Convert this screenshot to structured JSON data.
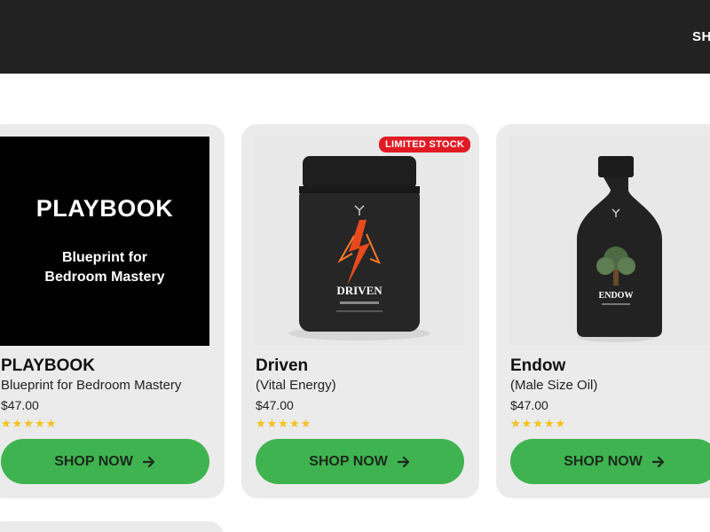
{
  "header": {
    "nav_shop": "SH"
  },
  "products": [
    {
      "name": "PLAYBOOK",
      "desc": "Blueprint for Bedroom Mastery",
      "price": "$47.00",
      "stars": "★★★★★",
      "cta": "SHOP NOW",
      "image": {
        "title": "PLAYBOOK",
        "sub1": "Blueprint for",
        "sub2": "Bedroom Mastery"
      }
    },
    {
      "name": "Driven",
      "desc": "(Vital Energy)",
      "price": "$47.00",
      "stars": "★★★★★",
      "cta": "SHOP NOW",
      "badge": "LIMITED STOCK",
      "image": {
        "label": "DRIVEN"
      }
    },
    {
      "name": "Endow",
      "desc": "(Male Size Oil)",
      "price": "$47.00",
      "stars": "★★★★★",
      "cta": "SHOP NOW",
      "image": {
        "label": "ENDOW"
      }
    }
  ],
  "colors": {
    "header_bg": "#222222",
    "card_bg": "#ebebeb",
    "cta_green": "#3fb34f",
    "badge_red": "#e01b24",
    "star": "#f2c21b"
  },
  "icons": {
    "cta_arrow": "arrow-right-icon"
  }
}
